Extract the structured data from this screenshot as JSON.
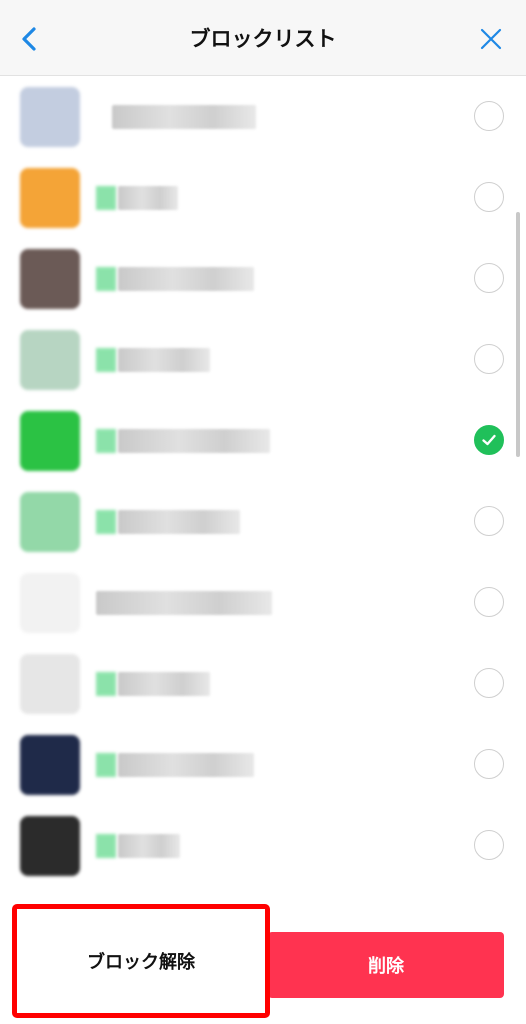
{
  "header": {
    "title": "ブロックリスト",
    "back_icon": "chevron-left-icon",
    "close_icon": "close-icon",
    "accent": "#1e88e5"
  },
  "list": {
    "rows": [
      {
        "avatar": "#c3cde0",
        "badge": false,
        "checked": false
      },
      {
        "avatar": "#f4a437",
        "badge": true,
        "checked": false
      },
      {
        "avatar": "#6b5a56",
        "badge": true,
        "checked": false
      },
      {
        "avatar": "#b7d5c2",
        "badge": true,
        "checked": false
      },
      {
        "avatar": "#2bc244",
        "badge": true,
        "checked": true
      },
      {
        "avatar": "#93d8a8",
        "badge": true,
        "checked": false
      },
      {
        "avatar": "#f2f2f2",
        "badge": false,
        "checked": false
      },
      {
        "avatar": "#e6e6e6",
        "badge": true,
        "checked": false
      },
      {
        "avatar": "#1f2a49",
        "badge": true,
        "checked": false
      },
      {
        "avatar": "#2b2b2b",
        "badge": true,
        "checked": false
      }
    ],
    "check_color": "#20c05a"
  },
  "actions": {
    "unblock_label": "ブロック解除",
    "delete_label": "削除",
    "delete_color": "#ff3350",
    "highlight_color": "#ff0000"
  }
}
